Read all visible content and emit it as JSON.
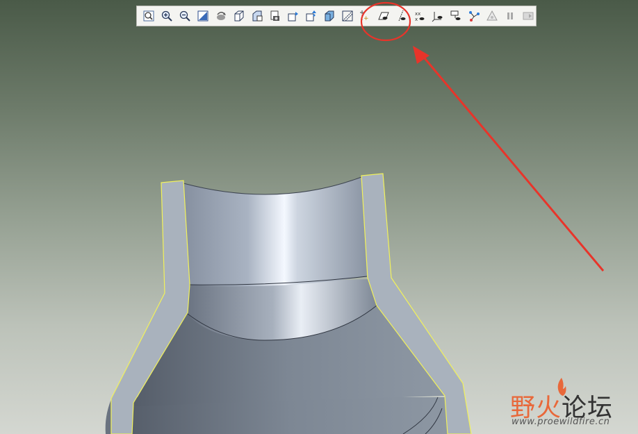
{
  "toolbar": {
    "buttons": [
      {
        "name": "refit-icon"
      },
      {
        "name": "zoom-in-icon"
      },
      {
        "name": "zoom-out-icon"
      },
      {
        "name": "repaint-icon"
      },
      {
        "name": "spin-center-icon"
      },
      {
        "name": "view-orient-icon"
      },
      {
        "name": "saved-views-icon"
      },
      {
        "name": "layers-icon"
      },
      {
        "name": "view-manager-icon"
      },
      {
        "name": "shading-icon"
      },
      {
        "name": "hidden-line-icon"
      },
      {
        "name": "wireframe-icon"
      },
      {
        "name": "datum-plane-display-icon"
      },
      {
        "name": "datum-axis-display-icon"
      },
      {
        "name": "point-display-icon"
      },
      {
        "name": "csys-display-icon"
      },
      {
        "name": "annotation-display-icon"
      },
      {
        "name": "network-icon"
      },
      {
        "name": "regenerate-icon"
      },
      {
        "name": "pause-icon"
      },
      {
        "name": "next-icon"
      }
    ]
  },
  "annotation": {
    "highlight_color": "#e8342a"
  },
  "watermark": {
    "title_part1": "野火",
    "title_part2": "论坛",
    "url": "www.proewildfire.cn"
  },
  "colors": {
    "model_outer": "#7f8a97",
    "model_section": "#a9b2bd",
    "section_edge": "#f2f25a"
  }
}
